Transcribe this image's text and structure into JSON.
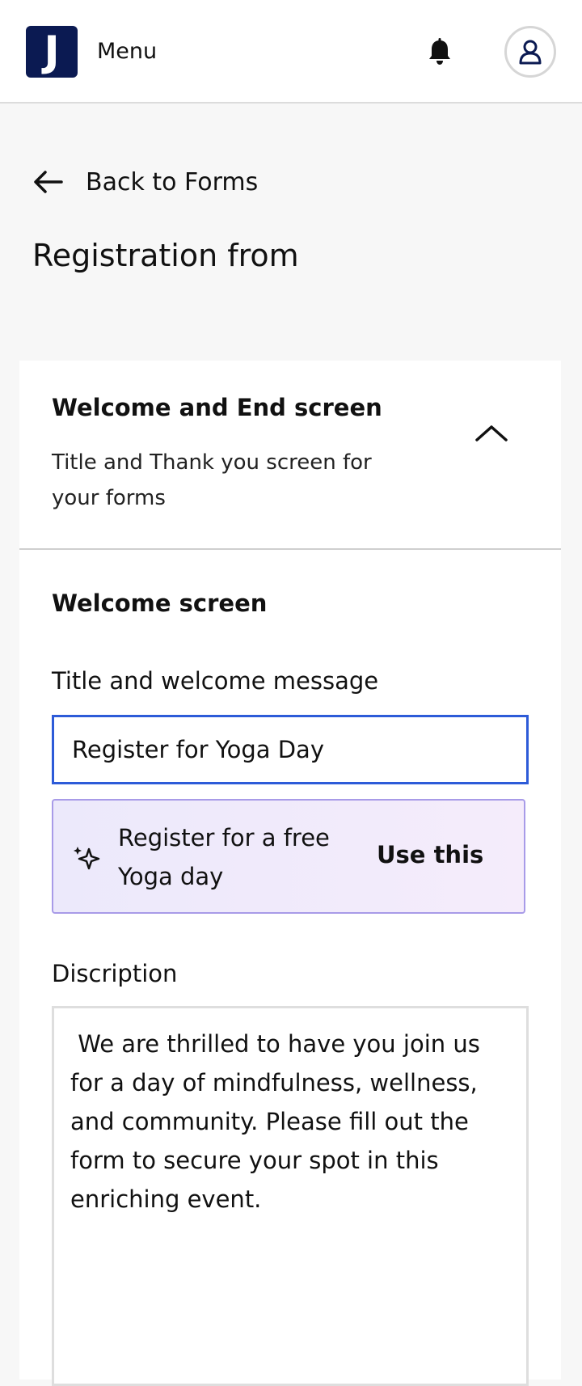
{
  "header": {
    "logo_letter": "J",
    "menu_label": "Menu",
    "brand_color": "#0b1a52",
    "bell_icon": "bell-icon",
    "avatar_icon": "user-icon"
  },
  "nav": {
    "back_label": "Back to Forms"
  },
  "page": {
    "title": "Registration from"
  },
  "section": {
    "title": "Welcome and End screen",
    "subtitle": "Title and Thank you screen for your forms",
    "collapse_icon": "chevron-up-icon"
  },
  "welcome": {
    "heading": "Welcome screen",
    "title_label": "Title and welcome message",
    "title_value": "Register for Yoga Day",
    "input_focus_color": "#2d5bd8",
    "suggestion": {
      "icon": "sparkle-icon",
      "text": "Register for a free Yoga day",
      "action_label": "Use this"
    },
    "description_label": "Discription",
    "description_value": " We are thrilled to have you join us for a day of mindfulness, wellness, and community. Please fill out the form to secure your spot in this enriching event."
  }
}
